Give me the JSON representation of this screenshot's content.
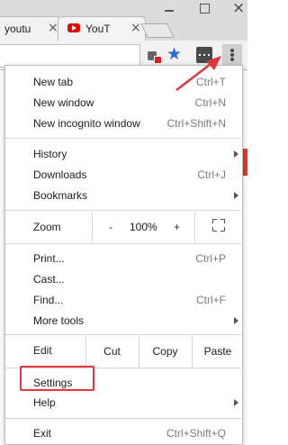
{
  "tabs": [
    {
      "label": "youtu",
      "close": "×"
    },
    {
      "label": "YouT",
      "close": "×"
    }
  ],
  "colors": {
    "accent_highlight": "#e0333a",
    "star": "#2a6cd8",
    "youtube_red": "#ee0000"
  },
  "toolbar": {
    "icons": [
      "extension-puzzle-icon",
      "bookmark-star-icon",
      "extension-icon",
      "menu-kebab-icon"
    ],
    "star_glyph": "★"
  },
  "menu": {
    "new_tab": {
      "label": "New tab",
      "shortcut": "Ctrl+T"
    },
    "new_window": {
      "label": "New window",
      "shortcut": "Ctrl+N"
    },
    "new_incognito": {
      "label": "New incognito window",
      "shortcut": "Ctrl+Shift+N"
    },
    "history": {
      "label": "History"
    },
    "downloads": {
      "label": "Downloads",
      "shortcut": "Ctrl+J"
    },
    "bookmarks": {
      "label": "Bookmarks"
    },
    "zoom": {
      "label": "Zoom",
      "minus": "-",
      "value": "100%",
      "plus": "+"
    },
    "print": {
      "label": "Print...",
      "shortcut": "Ctrl+P"
    },
    "cast": {
      "label": "Cast..."
    },
    "find": {
      "label": "Find...",
      "shortcut": "Ctrl+F"
    },
    "more_tools": {
      "label": "More tools"
    },
    "edit": {
      "label": "Edit",
      "cut": "Cut",
      "copy": "Copy",
      "paste": "Paste"
    },
    "settings": {
      "label": "Settings"
    },
    "help": {
      "label": "Help"
    },
    "exit": {
      "label": "Exit",
      "shortcut": "Ctrl+Shift+Q"
    }
  }
}
